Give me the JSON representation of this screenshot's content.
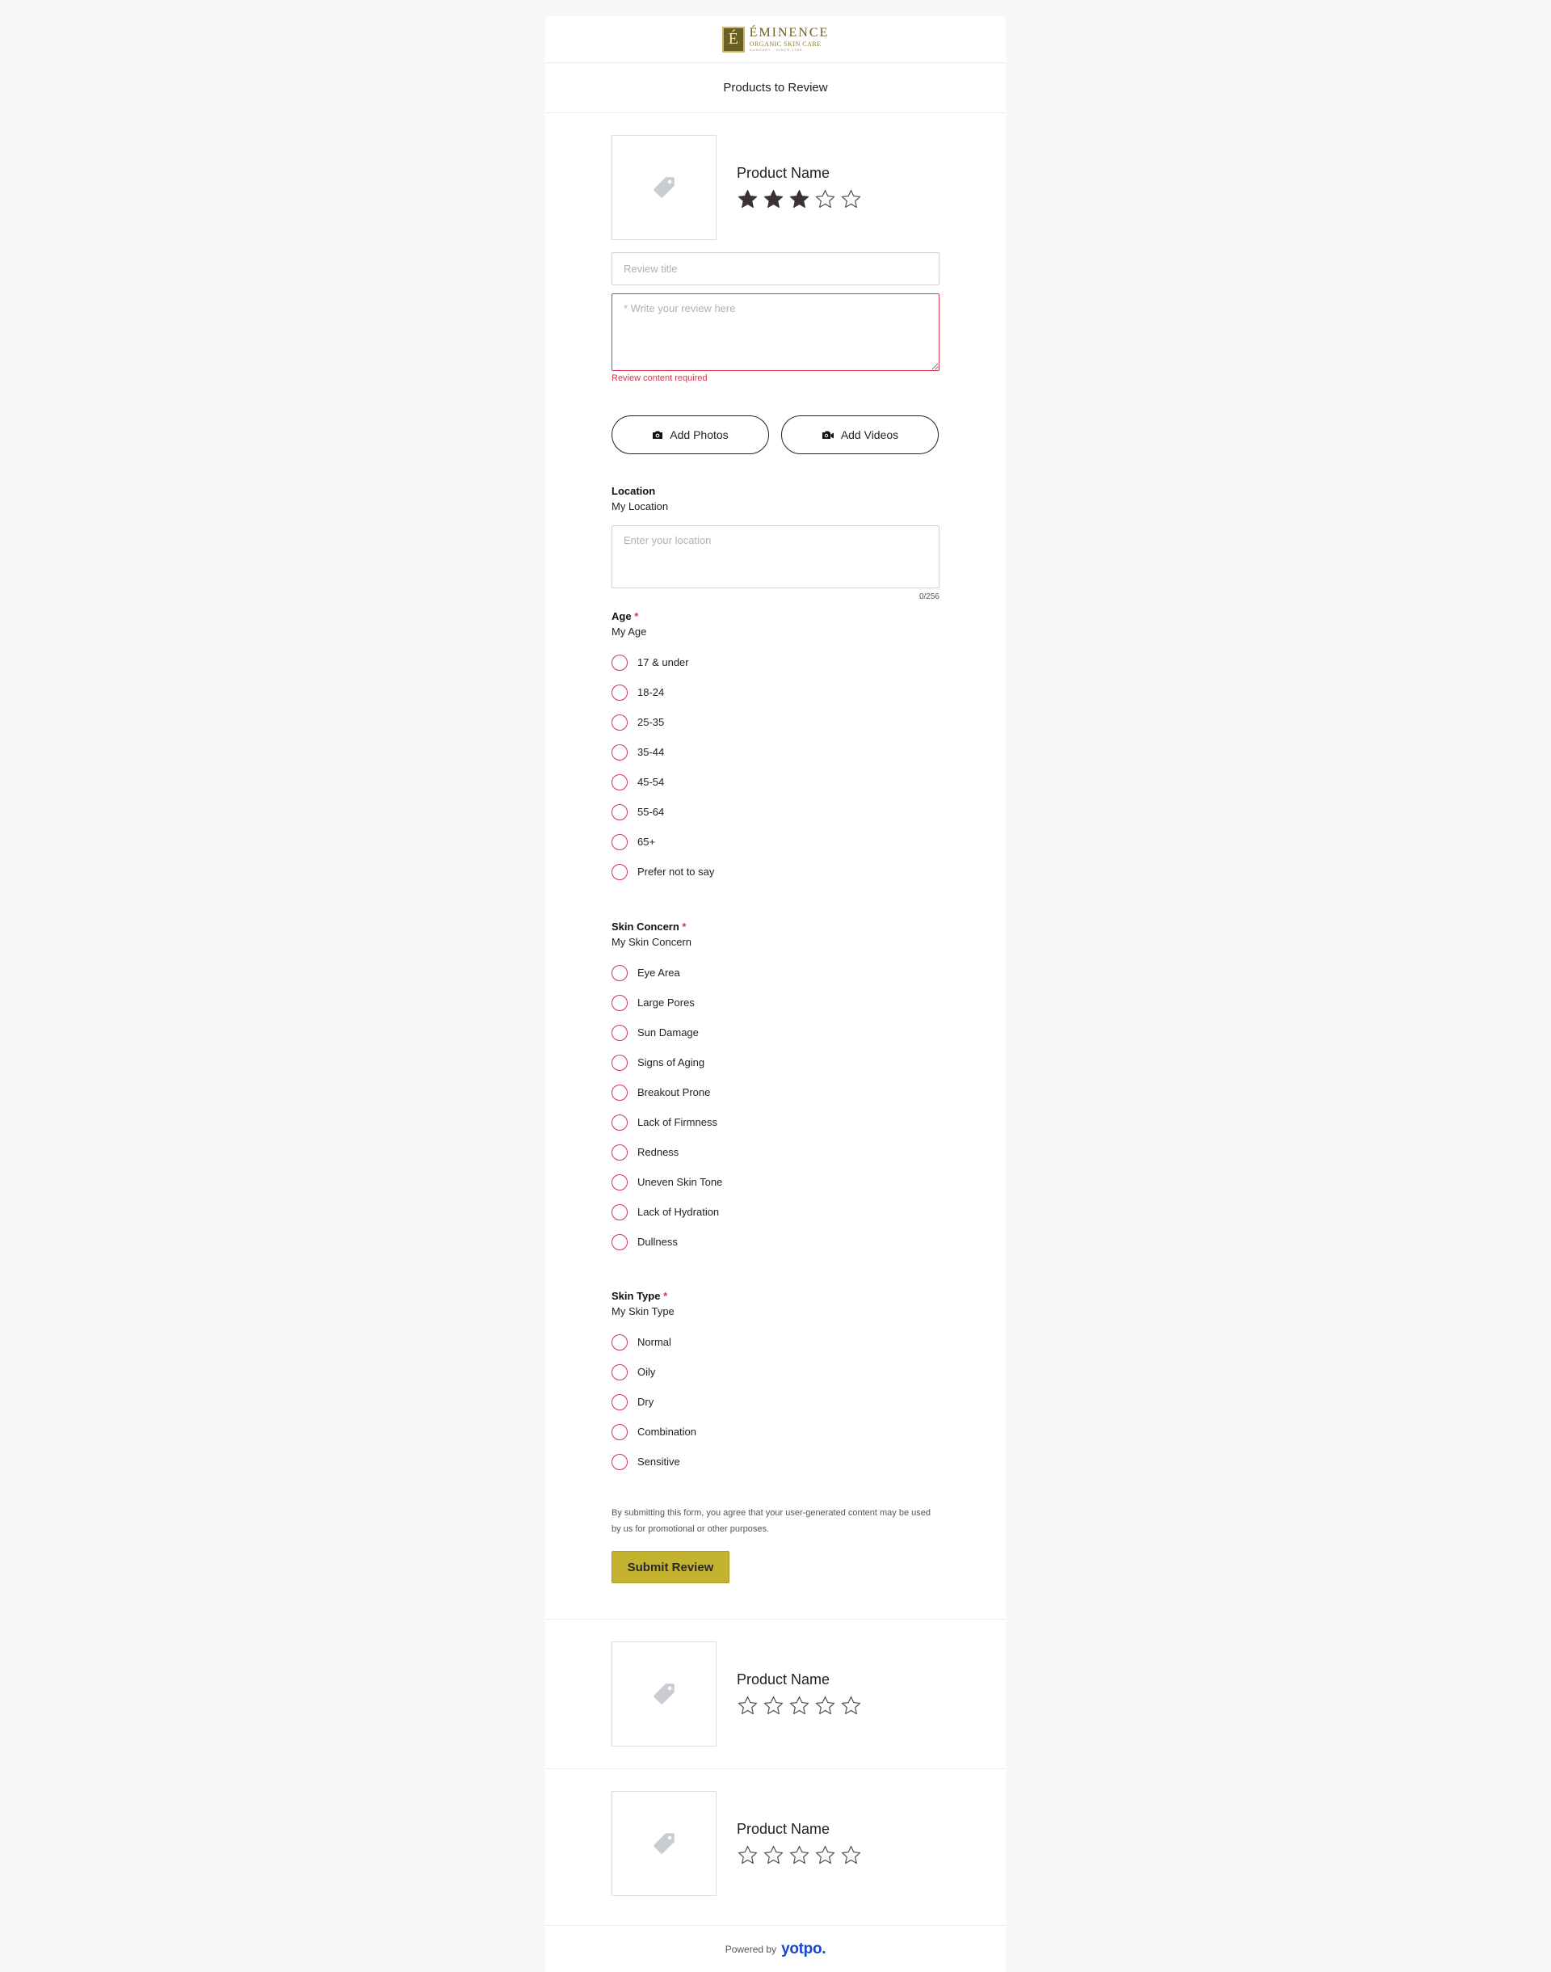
{
  "brand": {
    "mark": "É",
    "name": "ÉMINENCE",
    "subtitle": "ORGANIC SKIN CARE",
    "tagline": "HUNGARY · SINCE 1958"
  },
  "page": {
    "subtitle": "Products to Review"
  },
  "products": [
    {
      "name": "Product Name",
      "rating": 3
    },
    {
      "name": "Product Name",
      "rating": 0
    },
    {
      "name": "Product Name",
      "rating": 0
    }
  ],
  "form": {
    "review_title_placeholder": "Review title",
    "review_body_placeholder": "* Write your review here",
    "error": "Review content required",
    "add_photos": "Add Photos",
    "add_videos": "Add Videos",
    "location": {
      "label": "Location",
      "desc": "My Location",
      "placeholder": "Enter your location",
      "counter": "0/256"
    },
    "age": {
      "label": "Age",
      "req": "*",
      "desc": "My Age",
      "options": [
        "17 & under",
        "18-24",
        "25-35",
        "35-44",
        "45-54",
        "55-64",
        "65+",
        "Prefer not to say"
      ]
    },
    "skin_concern": {
      "label": "Skin Concern",
      "req": "*",
      "desc": "My Skin Concern",
      "options": [
        "Eye Area",
        "Large Pores",
        "Sun Damage",
        "Signs of Aging",
        "Breakout Prone",
        "Lack of Firmness",
        "Redness",
        "Uneven Skin Tone",
        "Lack of Hydration",
        "Dullness"
      ]
    },
    "skin_type": {
      "label": "Skin Type",
      "req": "*",
      "desc": "My Skin Type",
      "options": [
        "Normal",
        "Oily",
        "Dry",
        "Combination",
        "Sensitive"
      ]
    },
    "consent": "By submitting this form, you agree that your user-generated content may be used by us for promotional or other purposes.",
    "submit": "Submit Review"
  },
  "footer": {
    "powered_by": "Powered by",
    "brand": "yotpo."
  },
  "colors": {
    "accent_red": "#d8334f",
    "submit_bg": "#c3b32f",
    "star_fill": "#3a3233",
    "yotpo_blue": "#1b44d8"
  },
  "icons": {
    "product_placeholder": "tag-icon",
    "photos": "camera-icon",
    "videos": "video-camera-icon",
    "star": "star-icon"
  }
}
